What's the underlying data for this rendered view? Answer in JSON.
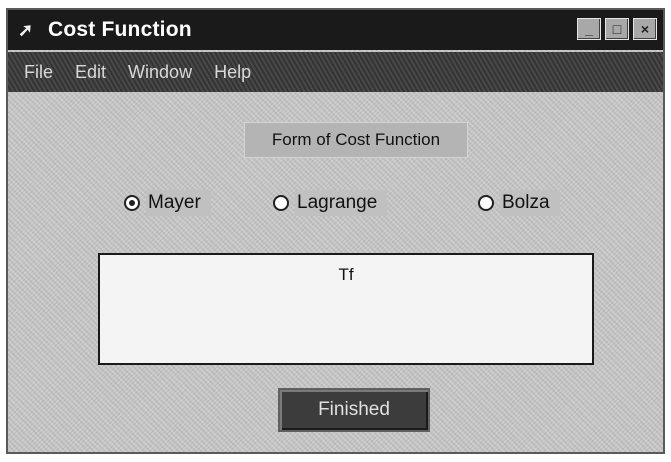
{
  "window": {
    "title": "Cost Function",
    "title_icon": "arrow-icon",
    "controls": [
      "minimize-icon",
      "maximize-icon",
      "close-icon"
    ]
  },
  "menu": {
    "items": [
      "File",
      "Edit",
      "Window",
      "Help"
    ]
  },
  "form": {
    "group_label": "Form of Cost Function",
    "options": [
      {
        "label": "Mayer",
        "selected": true
      },
      {
        "label": "Lagrange",
        "selected": false
      },
      {
        "label": "Bolza",
        "selected": false
      }
    ],
    "expression": "Tf"
  },
  "buttons": {
    "finished": "Finished"
  }
}
